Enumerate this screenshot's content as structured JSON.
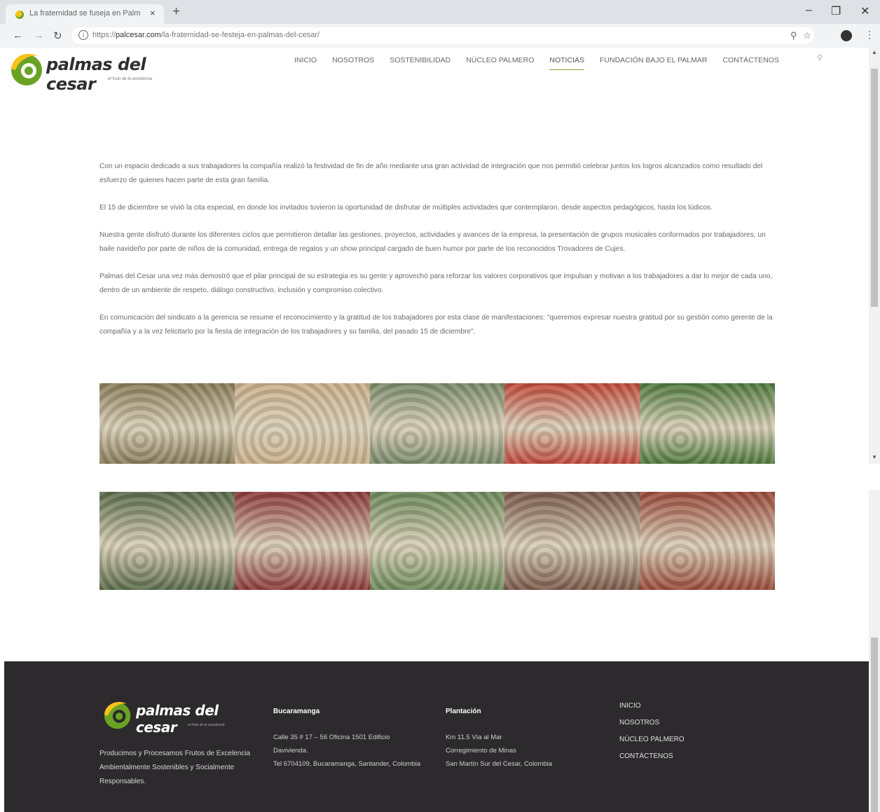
{
  "browser": {
    "tab_title": "La fraternidad se fuseja en Palm",
    "tab_close": "×",
    "new_tab": "+",
    "url_prefix": "https://",
    "url_domain": "palcesar.com",
    "url_path": "/la-fraternidad-se-festeja-en-palmas-del-cesar/",
    "minimize": "–",
    "maximize": "❐",
    "close": "✕"
  },
  "site": {
    "logo_text": "palmas del cesar",
    "logo_tagline": "el fruto de la excelencia",
    "nav": [
      "INICIO",
      "NOSOTROS",
      "SOSTENIBILIDAD",
      "NÚCLEO PALMERO",
      "NOTICIAS",
      "FUNDACIÓN BAJO EL PALMAR",
      "CONTÁCTENOS"
    ],
    "active_nav": "NOTICIAS"
  },
  "article": {
    "paragraphs": [
      "Con un espacio dedicado a sus trabajadores la compañía realizó la festividad de fin de año mediante una gran actividad de integración que nos permitió celebrar juntos los logros alcanzados como resultado del esfuerzo de quienes hacen parte de esta gran familia.",
      "El 15 de diciembre se vivió la cita especial, en donde los invitados tuvieron la oportunidad de disfrutar de múltiples actividades que contemplaron, desde aspectos pedagógicos, hasta los lúdicos.",
      "Nuestra gente disfrutó durante los diferentes ciclos que permitieron detallar las gestiones, proyectos, actividades y avances de la empresa, la presentación de grupos musicales conformados por trabajadores, un baile navideño por parte de niños de la comunidad, entrega de regalos y un show principal cargado de buen humor por parte de los reconocidos Trovadores de Cujes.",
      "Palmas del Cesar una vez más demostró que el pilar principal de su estrategia es su gente y aprovechó para reforzar los valores corporativos que impulsan y motivan a los trabajadores a dar lo mejor de cada uno, dentro de un ambiente de respeto, diálogo constructivo, inclusión y compromiso colectivo.",
      "En comunicación del sindicato a la gerencia se resume el reconocimiento y la gratitud de los trabajadores por esta clase de manifestaciones: \"queremos expresar nuestra gratitud por su gestión como gerente de la compañía y a la vez felicitarlo por la fiesta de integración de los trabajadores y su familia, del pasado 15 de diciembre\"."
    ]
  },
  "galleries": {
    "row1": [
      "#8a7d5a",
      "#c9b08a",
      "#7a8a6a",
      "#c0493a",
      "#4f7a3c"
    ],
    "row2": [
      "#5a6b4a",
      "#8c3a3a",
      "#6d8a5a",
      "#7b5a4a",
      "#9a4a3a"
    ]
  },
  "footer": {
    "logo_text": "palmas del cesar",
    "logo_tagline": "el fruto de la excelencia",
    "description": "Producimos y Procesamos Frutos de Excelencia Ambientalmente Sostenibles y Socialmente Responsables.",
    "col1_title": "Bucaramanga",
    "col1_text": "Calle 35 # 17 – 56 Oficina 1501 Edificio Davivienda.\nTel 6704109, Bucaramanga, Santander, Colombia",
    "col2_title": "Plantación",
    "col2_text": "Km 11.5 Vía al Mar\nCorregimiento de Minas\nSan Martín Sur del Cesar, Colombia",
    "menu": [
      "INICIO",
      "NOSOTROS",
      "NÚCLEO PALMERO",
      "CONTÁCTENOS"
    ]
  },
  "colors": {
    "brand_green": "#8aa533",
    "brand_yellow": "#f6c21c",
    "footer_bg": "#2c2a2c"
  }
}
